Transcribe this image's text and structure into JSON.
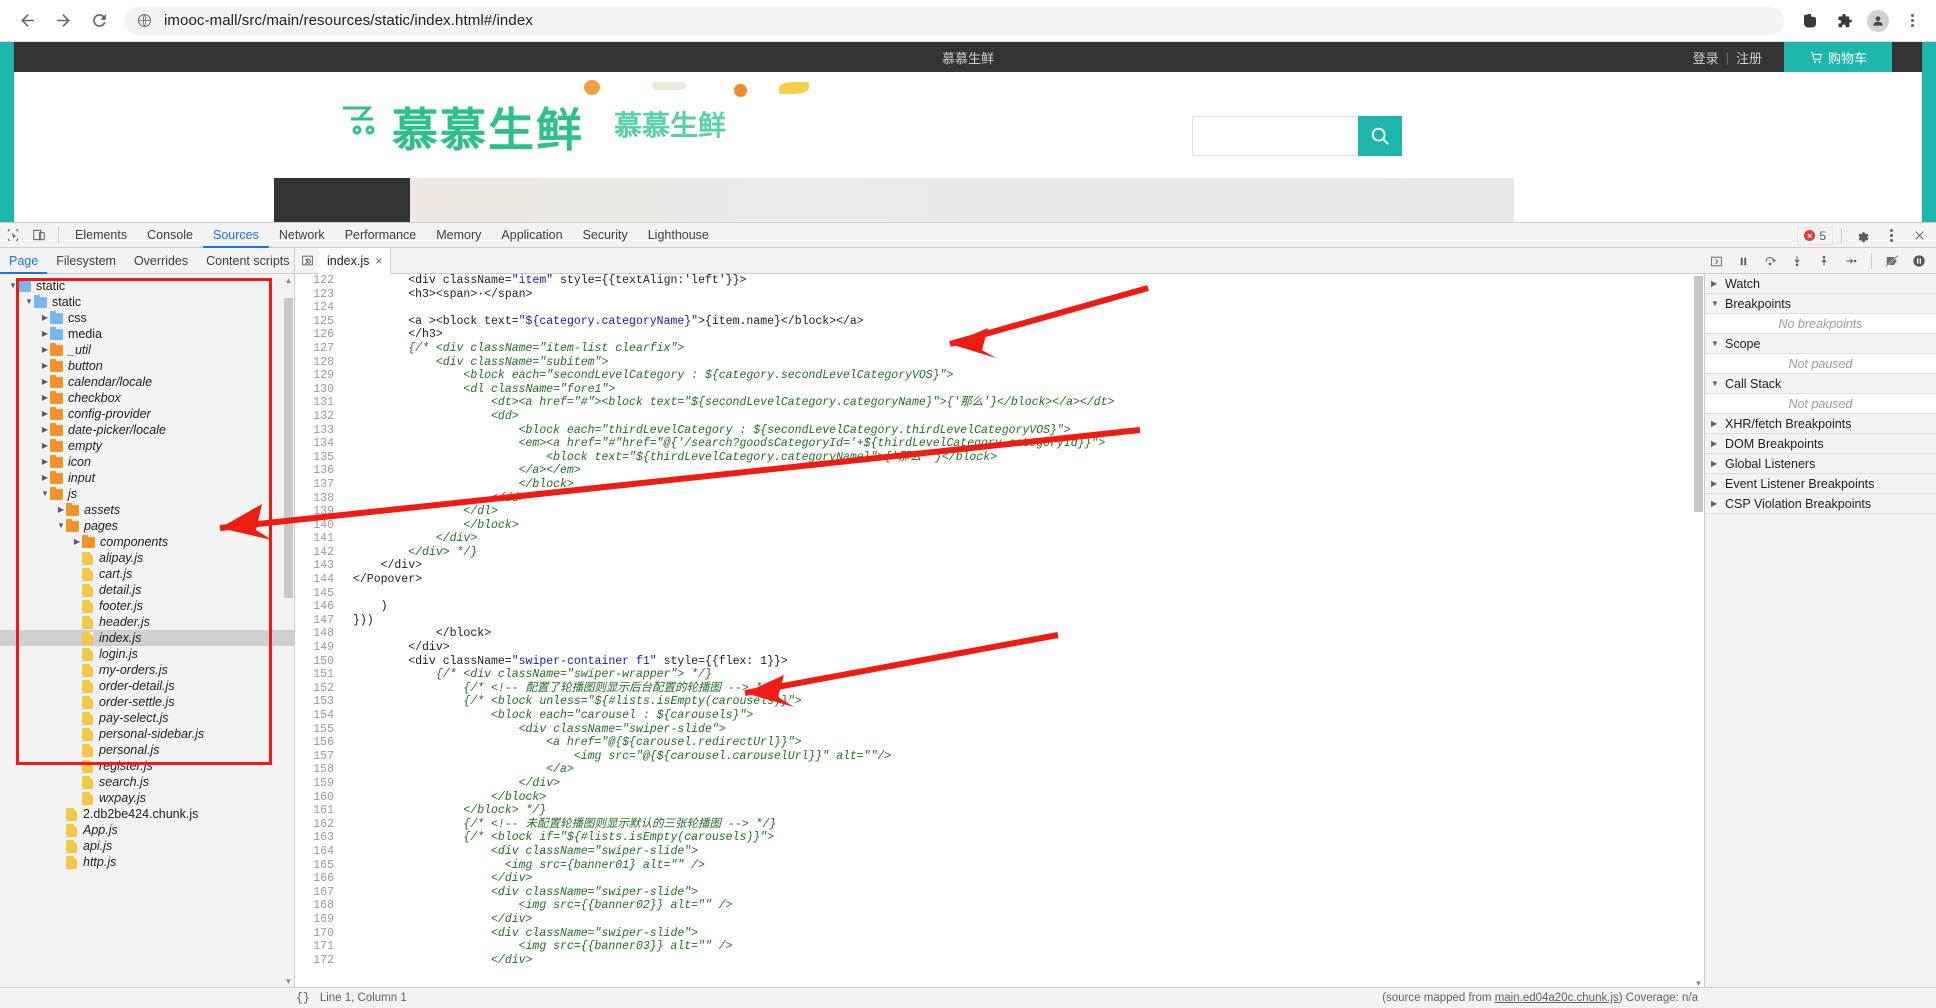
{
  "browser": {
    "url": "imooc-mall/src/main/resources/static/index.html#/index",
    "back_icon": "back-arrow-icon",
    "forward_icon": "forward-arrow-icon",
    "reload_icon": "reload-icon",
    "site_icon": "globe-icon",
    "actions": [
      {
        "name": "evernote-extension-icon"
      },
      {
        "name": "extensions-puzzle-icon"
      },
      {
        "name": "profile-avatar-icon"
      },
      {
        "name": "chrome-menu-kebab-icon"
      }
    ]
  },
  "site": {
    "brand_mini": "慕慕生鲜",
    "login_label": "登录",
    "separator": "|",
    "register_label": "注册",
    "cart_label": "购物车",
    "logo_text": "慕慕生鲜",
    "logo_ghost_text": "慕慕生鲜",
    "search_placeholder": "",
    "search_icon": "search-icon",
    "accent_color": "#1eb5ab",
    "logo_color": "#2fc08a"
  },
  "devtools": {
    "inspect_icon": "inspect-element-icon",
    "device_icon": "device-toolbar-icon",
    "tabs": [
      {
        "label": "Elements",
        "active": false
      },
      {
        "label": "Console",
        "active": false
      },
      {
        "label": "Sources",
        "active": true
      },
      {
        "label": "Network",
        "active": false
      },
      {
        "label": "Performance",
        "active": false
      },
      {
        "label": "Memory",
        "active": false
      },
      {
        "label": "Application",
        "active": false
      },
      {
        "label": "Security",
        "active": false
      },
      {
        "label": "Lighthouse",
        "active": false
      }
    ],
    "error_count": "5",
    "settings_icon": "gear-icon",
    "more_icon": "more-vertical-icon",
    "close_icon": "close-icon",
    "nav_tabs": [
      {
        "label": "Page",
        "active": true
      },
      {
        "label": "Filesystem",
        "active": false
      },
      {
        "label": "Overrides",
        "active": false
      },
      {
        "label": "Content scripts",
        "active": false
      }
    ],
    "nav_more": "»",
    "nav_kebab": "more-vertical-icon",
    "editor_tab": {
      "label": "index.js",
      "close": "×"
    },
    "panel_toggle_icon": "show-navigator-icon",
    "show_debugger_icon": "show-debugger-sidebar-icon",
    "debug_buttons": [
      {
        "name": "pause-resume-button",
        "glyph": "❙❙"
      },
      {
        "name": "step-over-button",
        "glyph": "⤻"
      },
      {
        "name": "step-into-button",
        "glyph": "↓"
      },
      {
        "name": "step-out-button",
        "glyph": "↑"
      },
      {
        "name": "step-button",
        "glyph": "→|"
      },
      {
        "name": "deactivate-breakpoints-button",
        "glyph": "⊘"
      },
      {
        "name": "pause-on-exceptions-button",
        "glyph": "❙❙"
      }
    ],
    "status": {
      "format_icon": "{}",
      "cursor": "Line 1, Column 1",
      "source_map": "(source mapped from ",
      "source_map_link": "main.ed04a20c.chunk.js",
      "source_map_tail": ")  Coverage: n/a"
    }
  },
  "file_tree": [
    {
      "label": "static",
      "indent": 0,
      "type": "folder-blue",
      "twisty": "open",
      "italic": false,
      "selected": false
    },
    {
      "label": "static",
      "indent": 1,
      "type": "folder-blue",
      "twisty": "open",
      "italic": false,
      "selected": false
    },
    {
      "label": "css",
      "indent": 2,
      "type": "folder-blue",
      "twisty": "closed",
      "italic": false,
      "selected": false
    },
    {
      "label": "media",
      "indent": 2,
      "type": "folder-blue",
      "twisty": "closed",
      "italic": false,
      "selected": false
    },
    {
      "label": "_util",
      "indent": 2,
      "type": "folder-orange",
      "twisty": "closed",
      "italic": true,
      "selected": false
    },
    {
      "label": "button",
      "indent": 2,
      "type": "folder-orange",
      "twisty": "closed",
      "italic": true,
      "selected": false
    },
    {
      "label": "calendar/locale",
      "indent": 2,
      "type": "folder-orange",
      "twisty": "closed",
      "italic": true,
      "selected": false
    },
    {
      "label": "checkbox",
      "indent": 2,
      "type": "folder-orange",
      "twisty": "closed",
      "italic": true,
      "selected": false
    },
    {
      "label": "config-provider",
      "indent": 2,
      "type": "folder-orange",
      "twisty": "closed",
      "italic": true,
      "selected": false
    },
    {
      "label": "date-picker/locale",
      "indent": 2,
      "type": "folder-orange",
      "twisty": "closed",
      "italic": true,
      "selected": false
    },
    {
      "label": "empty",
      "indent": 2,
      "type": "folder-orange",
      "twisty": "closed",
      "italic": true,
      "selected": false
    },
    {
      "label": "icon",
      "indent": 2,
      "type": "folder-orange",
      "twisty": "closed",
      "italic": true,
      "selected": false
    },
    {
      "label": "input",
      "indent": 2,
      "type": "folder-orange",
      "twisty": "closed",
      "italic": true,
      "selected": false
    },
    {
      "label": "js",
      "indent": 2,
      "type": "folder-orange",
      "twisty": "open",
      "italic": true,
      "selected": false
    },
    {
      "label": "assets",
      "indent": 3,
      "type": "folder-orange",
      "twisty": "closed",
      "italic": true,
      "selected": false
    },
    {
      "label": "pages",
      "indent": 3,
      "type": "folder-orange",
      "twisty": "open",
      "italic": true,
      "selected": false
    },
    {
      "label": "components",
      "indent": 4,
      "type": "folder-orange",
      "twisty": "closed",
      "italic": true,
      "selected": false
    },
    {
      "label": "alipay.js",
      "indent": 4,
      "type": "file-js",
      "twisty": "none",
      "italic": true,
      "selected": false
    },
    {
      "label": "cart.js",
      "indent": 4,
      "type": "file-js",
      "twisty": "none",
      "italic": true,
      "selected": false
    },
    {
      "label": "detail.js",
      "indent": 4,
      "type": "file-js",
      "twisty": "none",
      "italic": true,
      "selected": false
    },
    {
      "label": "footer.js",
      "indent": 4,
      "type": "file-js",
      "twisty": "none",
      "italic": true,
      "selected": false
    },
    {
      "label": "header.js",
      "indent": 4,
      "type": "file-js",
      "twisty": "none",
      "italic": true,
      "selected": false
    },
    {
      "label": "index.js",
      "indent": 4,
      "type": "file-js",
      "twisty": "none",
      "italic": true,
      "selected": true
    },
    {
      "label": "login.js",
      "indent": 4,
      "type": "file-js",
      "twisty": "none",
      "italic": true,
      "selected": false
    },
    {
      "label": "my-orders.js",
      "indent": 4,
      "type": "file-js",
      "twisty": "none",
      "italic": true,
      "selected": false
    },
    {
      "label": "order-detail.js",
      "indent": 4,
      "type": "file-js",
      "twisty": "none",
      "italic": true,
      "selected": false
    },
    {
      "label": "order-settle.js",
      "indent": 4,
      "type": "file-js",
      "twisty": "none",
      "italic": true,
      "selected": false
    },
    {
      "label": "pay-select.js",
      "indent": 4,
      "type": "file-js",
      "twisty": "none",
      "italic": true,
      "selected": false
    },
    {
      "label": "personal-sidebar.js",
      "indent": 4,
      "type": "file-js",
      "twisty": "none",
      "italic": true,
      "selected": false
    },
    {
      "label": "personal.js",
      "indent": 4,
      "type": "file-js",
      "twisty": "none",
      "italic": true,
      "selected": false
    },
    {
      "label": "register.js",
      "indent": 4,
      "type": "file-js",
      "twisty": "none",
      "italic": true,
      "selected": false
    },
    {
      "label": "search.js",
      "indent": 4,
      "type": "file-js",
      "twisty": "none",
      "italic": true,
      "selected": false
    },
    {
      "label": "wxpay.js",
      "indent": 4,
      "type": "file-js",
      "twisty": "none",
      "italic": true,
      "selected": false
    },
    {
      "label": "2.db2be424.chunk.js",
      "indent": 3,
      "type": "file-js",
      "twisty": "none",
      "italic": false,
      "selected": false
    },
    {
      "label": "App.js",
      "indent": 3,
      "type": "file-js",
      "twisty": "none",
      "italic": true,
      "selected": false
    },
    {
      "label": "api.js",
      "indent": 3,
      "type": "file-js",
      "twisty": "none",
      "italic": true,
      "selected": false
    },
    {
      "label": "http.js",
      "indent": 3,
      "type": "file-js",
      "twisty": "none",
      "italic": true,
      "selected": false
    }
  ],
  "code_lines": [
    {
      "n": "122",
      "text": "        <div className=\"item\" style={{textAlign:'left'}}>"
    },
    {
      "n": "123",
      "text": "        <h3><span>·</span>"
    },
    {
      "n": "124",
      "text": ""
    },
    {
      "n": "125",
      "text": "        <a ><block text=\"${category.categoryName}\">{item.name}</block></a>"
    },
    {
      "n": "126",
      "text": "        </h3>"
    },
    {
      "n": "127",
      "text": "        {/* <div className=\"item-list clearfix\">"
    },
    {
      "n": "128",
      "text": "            <div className=\"subitem\">"
    },
    {
      "n": "129",
      "text": "                <block each=\"secondLevelCategory : ${category.secondLevelCategoryVOS}\">"
    },
    {
      "n": "130",
      "text": "                <dl className=\"fore1\">"
    },
    {
      "n": "131",
      "text": "                    <dt><a href=\"#\"><block text=\"${secondLevelCategory.categoryName}\">{'那么'}</block></a></dt>"
    },
    {
      "n": "132",
      "text": "                    <dd>"
    },
    {
      "n": "133",
      "text": "                        <block each=\"thirdLevelCategory : ${secondLevelCategory.thirdLevelCategoryVOS}\">"
    },
    {
      "n": "134",
      "text": "                        <em><a href=\"#\"href=\"@{'/search?goodsCategoryId='+${thirdLevelCategory.categoryId}}\">"
    },
    {
      "n": "135",
      "text": "                            <block text=\"${thirdLevelCategory.categoryName}\">{'那么 '}</block>"
    },
    {
      "n": "136",
      "text": "                        </a></em>"
    },
    {
      "n": "137",
      "text": "                        </block>"
    },
    {
      "n": "138",
      "text": "                    </dd>"
    },
    {
      "n": "139",
      "text": "                </dl>"
    },
    {
      "n": "140",
      "text": "                </block>"
    },
    {
      "n": "141",
      "text": "            </div>"
    },
    {
      "n": "142",
      "text": "        </div> */}"
    },
    {
      "n": "143",
      "text": "    </div>"
    },
    {
      "n": "144",
      "text": "</Popover>"
    },
    {
      "n": "145",
      "text": ""
    },
    {
      "n": "146",
      "text": "    )"
    },
    {
      "n": "147",
      "text": "}))"
    },
    {
      "n": "148",
      "text": "            </block>"
    },
    {
      "n": "149",
      "text": "        </div>"
    },
    {
      "n": "150",
      "text": "        <div className=\"swiper-container f1\" style={{flex: 1}}>"
    },
    {
      "n": "151",
      "text": "            {/* <div className=\"swiper-wrapper\"> */}"
    },
    {
      "n": "152",
      "text": "                {/* <!-- 配置了轮播图则显示后台配置的轮播图 --> */}"
    },
    {
      "n": "153",
      "text": "                {/* <block unless=\"${#lists.isEmpty(carousels)}\">"
    },
    {
      "n": "154",
      "text": "                    <block each=\"carousel : ${carousels}\">"
    },
    {
      "n": "155",
      "text": "                        <div className=\"swiper-slide\">"
    },
    {
      "n": "156",
      "text": "                            <a href=\"@{${carousel.redirectUrl}}\">"
    },
    {
      "n": "157",
      "text": "                                <img src=\"@{${carousel.carouselUrl}}\" alt=\"\"/>"
    },
    {
      "n": "158",
      "text": "                            </a>"
    },
    {
      "n": "159",
      "text": "                        </div>"
    },
    {
      "n": "160",
      "text": "                    </block>"
    },
    {
      "n": "161",
      "text": "                </block> */}"
    },
    {
      "n": "162",
      "text": "                {/* <!-- 未配置轮播图则显示默认的三张轮播图 --> */}"
    },
    {
      "n": "163",
      "text": "                {/* <block if=\"${#lists.isEmpty(carousels)}\">"
    },
    {
      "n": "164",
      "text": "                    <div className=\"swiper-slide\">"
    },
    {
      "n": "165",
      "text": "                      <img src={banner01} alt=\"\" />"
    },
    {
      "n": "166",
      "text": "                    </div>"
    },
    {
      "n": "167",
      "text": "                    <div className=\"swiper-slide\">"
    },
    {
      "n": "168",
      "text": "                        <img src={{banner02}} alt=\"\" />"
    },
    {
      "n": "169",
      "text": "                    </div>"
    },
    {
      "n": "170",
      "text": "                    <div className=\"swiper-slide\">"
    },
    {
      "n": "171",
      "text": "                        <img src={{banner03}} alt=\"\" />"
    },
    {
      "n": "172",
      "text": "                    </div>"
    }
  ],
  "debugger_sidebar": [
    {
      "label": "Watch",
      "state": "collapsed",
      "empty": null
    },
    {
      "label": "Breakpoints",
      "state": "expanded",
      "empty": "No breakpoints"
    },
    {
      "label": "Scope",
      "state": "expanded",
      "empty": "Not paused"
    },
    {
      "label": "Call Stack",
      "state": "expanded",
      "empty": "Not paused"
    },
    {
      "label": "XHR/fetch Breakpoints",
      "state": "collapsed",
      "empty": null
    },
    {
      "label": "DOM Breakpoints",
      "state": "collapsed",
      "empty": null
    },
    {
      "label": "Global Listeners",
      "state": "collapsed",
      "empty": null
    },
    {
      "label": "Event Listener Breakpoints",
      "state": "collapsed",
      "empty": null
    },
    {
      "label": "CSP Violation Breakpoints",
      "state": "collapsed",
      "empty": null
    }
  ],
  "annotations": {
    "highlight_color": "#ee1c13",
    "box_label": "file-tree-highlight",
    "arrows": 2
  }
}
